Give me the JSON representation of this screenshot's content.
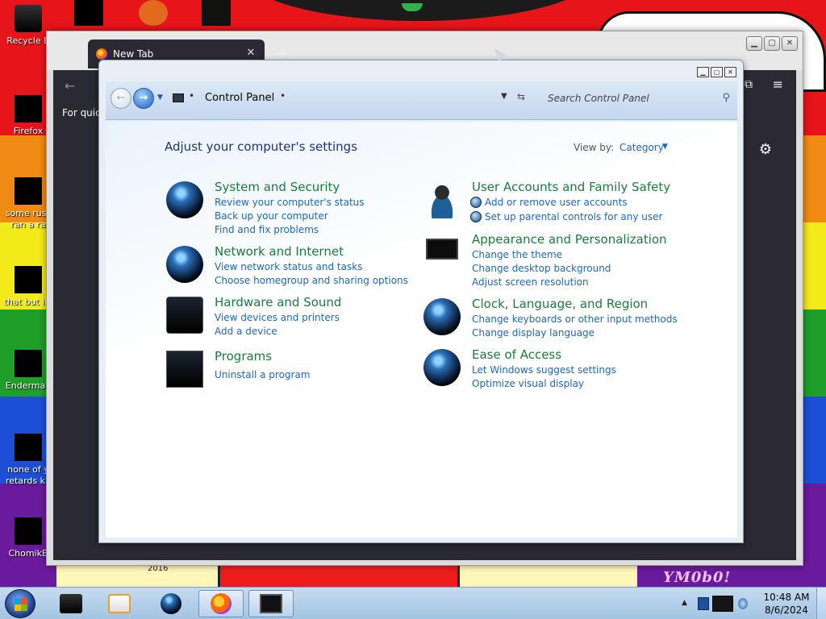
{
  "desktop": {
    "icons": [
      {
        "label": "Recycle B",
        "icon": "recycle-bin-icon"
      },
      {
        "label": "Firefox",
        "icon": "firefox-icon"
      },
      {
        "label": "some russ ran a ra",
        "icon": "file-icon"
      },
      {
        "label": "that but its",
        "icon": "file-icon"
      },
      {
        "label": "Enderman",
        "icon": "app-icon"
      },
      {
        "label": "none of y retards kn",
        "icon": "file-icon"
      },
      {
        "label": "ChomikB",
        "icon": "app-icon"
      }
    ],
    "wallpaper_text": {
      "mark": "YM0b0!",
      "year": "2016"
    }
  },
  "firefox": {
    "tab_title": "New Tab",
    "new_tab_symbol": "+",
    "quick_text": "For quick",
    "window_controls": [
      "minimize",
      "maximize",
      "close"
    ]
  },
  "control_panel": {
    "address": {
      "location": "Control Panel"
    },
    "search": {
      "placeholder": "Search Control Panel"
    },
    "heading": "Adjust your computer's settings",
    "view_by": {
      "label": "View by:",
      "value": "Category"
    },
    "categories": [
      {
        "title": "System and Security",
        "icon": "system-security-icon",
        "links": [
          "Review your computer's status",
          "Back up your computer",
          "Find and fix problems"
        ]
      },
      {
        "title": "Network and Internet",
        "icon": "network-globe-icon",
        "links": [
          "View network status and tasks",
          "Choose homegroup and sharing options"
        ]
      },
      {
        "title": "Hardware and Sound",
        "icon": "printer-icon",
        "links": [
          "View devices and printers",
          "Add a device"
        ]
      },
      {
        "title": "Programs",
        "icon": "programs-icon",
        "links": [
          "Uninstall a program"
        ]
      },
      {
        "title": "User Accounts and Family Safety",
        "icon": "users-icon",
        "links": [
          "Add or remove user accounts",
          "Set up parental controls for any user"
        ]
      },
      {
        "title": "Appearance and Personalization",
        "icon": "monitor-icon",
        "links": [
          "Change the theme",
          "Change desktop background",
          "Adjust screen resolution"
        ]
      },
      {
        "title": "Clock, Language, and Region",
        "icon": "clock-globe-icon",
        "links": [
          "Change keyboards or other input methods",
          "Change display language"
        ]
      },
      {
        "title": "Ease of Access",
        "icon": "ease-of-access-icon",
        "links": [
          "Let Windows suggest settings",
          "Optimize visual display"
        ]
      }
    ]
  },
  "taskbar": {
    "pinned": [
      "computer-icon",
      "media-player-icon",
      "globe-icon",
      "firefox-icon",
      "control-panel-icon"
    ],
    "clock": {
      "time": "10:48 AM",
      "date": "8/6/2024"
    }
  }
}
